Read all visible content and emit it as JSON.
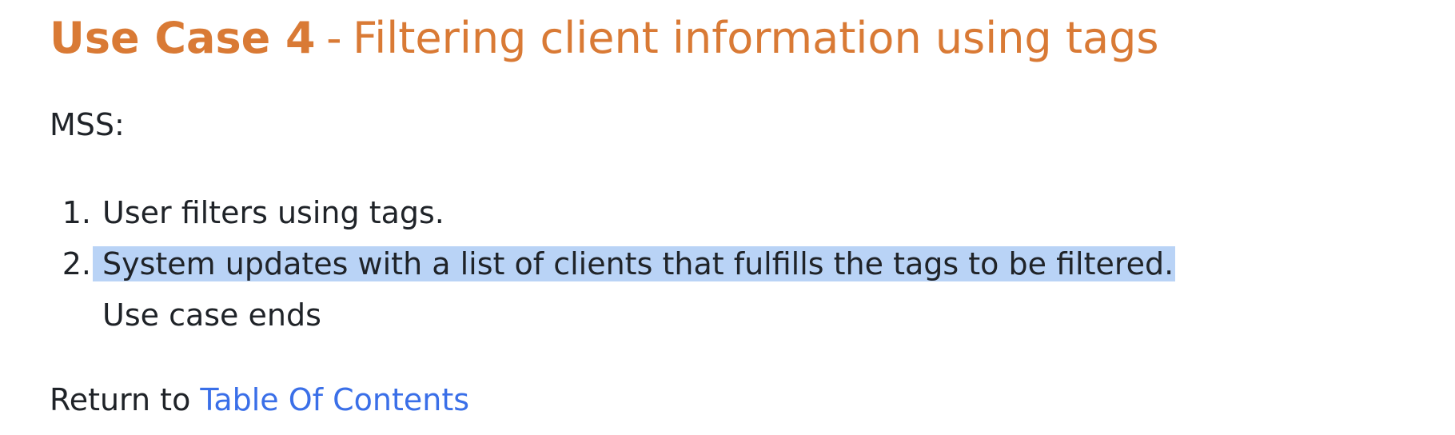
{
  "heading": {
    "label": "Use Case 4",
    "separator": "-",
    "title": "Filtering client information using tags",
    "color": "#d97a35"
  },
  "mss_label": "MSS:",
  "steps": [
    {
      "number": "1.",
      "text": "User filters using tags."
    },
    {
      "number": "2.",
      "text": "System updates with a list of clients that fulfills the tags to be filtered.",
      "selected": true
    }
  ],
  "use_case_ends": "Use case ends",
  "footer": {
    "prefix": "Return to",
    "link_text": "Table Of Contents",
    "link_color": "#3a6fe8"
  },
  "selection_color": "#b9d3f6"
}
